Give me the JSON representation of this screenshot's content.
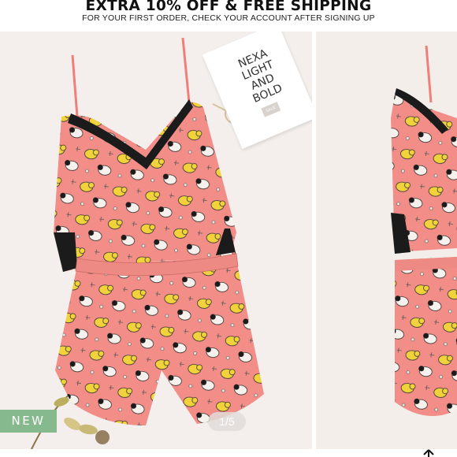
{
  "promo": {
    "title": "EXTRA 10% OFF & FREE SHIPPING",
    "subtitle": "FOR YOUR FIRST ORDER, CHECK YOUR ACCOUNT AFTER SIGNING UP"
  },
  "gallery": {
    "badge": "NEW",
    "pager": "1/5",
    "card_text": "NEXA LIGHT AND BOLD",
    "card_tag": "SALE",
    "product_pattern": "cat-print",
    "colors": {
      "fabric": "#f28d87",
      "lace": "#1b1b1b",
      "cat_yellow": "#f2d23a",
      "cat_white": "#f6f1ec",
      "badge": "#86b98d",
      "background": "#f4efec"
    }
  },
  "icons": {
    "scroll_top": "arrow-up-icon"
  }
}
